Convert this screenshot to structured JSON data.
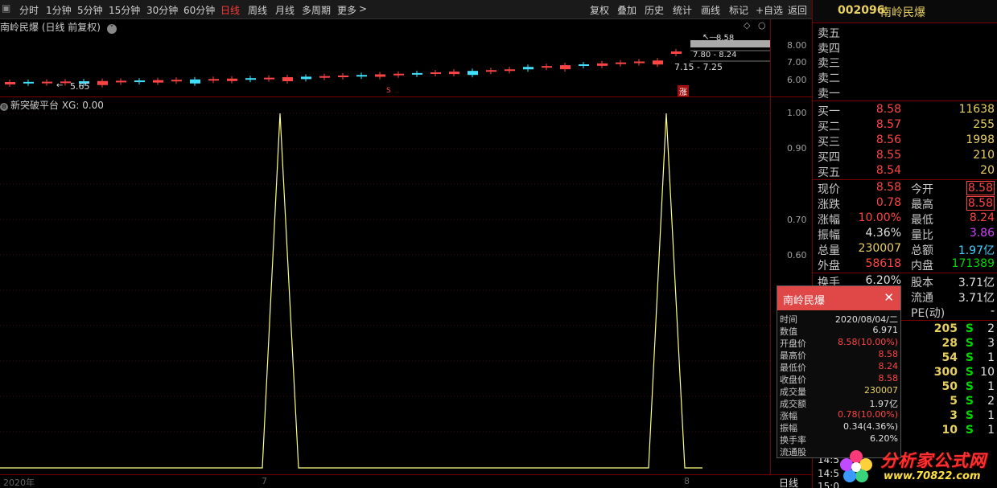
{
  "toolbar": {
    "periods": [
      "分时",
      "1分钟",
      "5分钟",
      "15分钟",
      "30分钟",
      "60分钟",
      "日线",
      "周线",
      "月线",
      "多周期",
      "更多"
    ],
    "active_period": "日线",
    "more_arrow": ">",
    "actions": [
      "复权",
      "叠加",
      "历史",
      "统计",
      "画线",
      "标记",
      "+自选",
      "返回"
    ]
  },
  "main_chart": {
    "header": "南岭民爆 (日线 前复权)",
    "price_labels": [
      "8.00",
      "7.00",
      "6.00"
    ],
    "annotations": {
      "high": "8.58",
      "range1": "7.80 - 8.24",
      "range2": "7.15 - 7.25",
      "low": "5.65",
      "marker_s": "S",
      "marker_zhang": "涨"
    }
  },
  "indicator": {
    "header": "新突破平台 XG: 0.00",
    "y_labels": [
      "1.00",
      "0.90",
      "0.70",
      "0.60"
    ]
  },
  "x_axis": {
    "labels": [
      "2020年",
      "7",
      "8"
    ],
    "period": "日线"
  },
  "quote": {
    "code": "002096",
    "name": "南岭民爆",
    "asks": [
      {
        "label": "卖五",
        "price": "",
        "vol": ""
      },
      {
        "label": "卖四",
        "price": "",
        "vol": ""
      },
      {
        "label": "卖三",
        "price": "",
        "vol": ""
      },
      {
        "label": "卖二",
        "price": "",
        "vol": ""
      },
      {
        "label": "卖一",
        "price": "",
        "vol": ""
      }
    ],
    "bids": [
      {
        "label": "买一",
        "price": "8.58",
        "vol": "11638"
      },
      {
        "label": "买二",
        "price": "8.57",
        "vol": "255"
      },
      {
        "label": "买三",
        "price": "8.56",
        "vol": "1998"
      },
      {
        "label": "买四",
        "price": "8.55",
        "vol": "210"
      },
      {
        "label": "买五",
        "price": "8.54",
        "vol": "20"
      }
    ],
    "stats": [
      {
        "l1": "现价",
        "v1": "8.58",
        "l2": "今开",
        "v2": "8.58"
      },
      {
        "l1": "涨跌",
        "v1": "0.78",
        "l2": "最高",
        "v2": "8.58"
      },
      {
        "l1": "涨幅",
        "v1": "10.00%",
        "l2": "最低",
        "v2": "8.24"
      },
      {
        "l1": "振幅",
        "v1": "4.36%",
        "l2": "量比",
        "v2": "3.86"
      },
      {
        "l1": "总量",
        "v1": "230007",
        "l2": "总额",
        "v2": "1.97亿"
      },
      {
        "l1": "外盘",
        "v1": "58618",
        "l2": "内盘",
        "v2": "171389"
      }
    ],
    "stats2": [
      {
        "l1": "换手",
        "v1": "6.20%",
        "l2": "股本",
        "v2": "3.71亿"
      },
      {
        "l1": "",
        "v1": "",
        "l2": "流通",
        "v2": "3.71亿"
      },
      {
        "l1": "",
        "v1": "",
        "l2": "PE(动)",
        "v2": "-"
      }
    ],
    "ticks": [
      {
        "vol": "205",
        "side": "S",
        "n": "2"
      },
      {
        "vol": "28",
        "side": "S",
        "n": "3"
      },
      {
        "vol": "54",
        "side": "S",
        "n": "1"
      },
      {
        "vol": "300",
        "side": "S",
        "n": "10"
      },
      {
        "vol": "50",
        "side": "S",
        "n": "1"
      },
      {
        "vol": "5",
        "side": "S",
        "n": "2"
      },
      {
        "vol": "3",
        "side": "S",
        "n": "1"
      },
      {
        "vol": "10",
        "side": "S",
        "n": "1"
      }
    ],
    "tick_times": [
      "14:5",
      "14:5",
      "15:0"
    ]
  },
  "tooltip": {
    "title": "南岭民爆",
    "close": "✕",
    "rows": [
      {
        "k": "时间",
        "v": "2020/08/04/二",
        "c": "white"
      },
      {
        "k": "数值",
        "v": "6.971",
        "c": "white"
      },
      {
        "k": "开盘价",
        "v": "8.58(10.00%)",
        "c": "red"
      },
      {
        "k": "最高价",
        "v": "8.58",
        "c": "red"
      },
      {
        "k": "最低价",
        "v": "8.24",
        "c": "red"
      },
      {
        "k": "收盘价",
        "v": "8.58",
        "c": "red"
      },
      {
        "k": "成交量",
        "v": "230007",
        "c": "yellow"
      },
      {
        "k": "成交额",
        "v": "1.97亿",
        "c": "white"
      },
      {
        "k": "涨幅",
        "v": "0.78(10.00%)",
        "c": "red"
      },
      {
        "k": "振幅",
        "v": "0.34(4.36%)",
        "c": "white"
      },
      {
        "k": "换手率",
        "v": "6.20%",
        "c": "white"
      },
      {
        "k": "流通股",
        "v": "",
        "c": "white"
      }
    ]
  },
  "watermark": {
    "text": "分析家公式网",
    "url": "www.70822.com"
  },
  "colors": {
    "up": "#ff4444",
    "down": "#40e0ff",
    "indicator_line": "#ffff80",
    "separator": "#7a0000"
  }
}
